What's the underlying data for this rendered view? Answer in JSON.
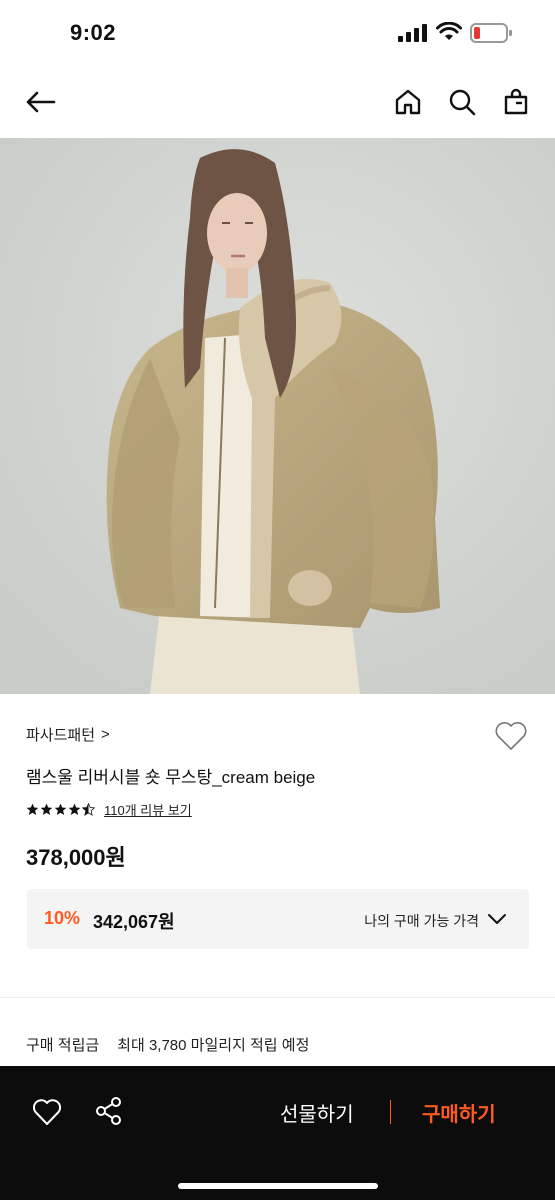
{
  "status_bar": {
    "time": "9:02"
  },
  "nav": {
    "back_icon": "arrow-left-icon",
    "home_icon": "home-icon",
    "search_icon": "search-icon",
    "bag_icon": "shopping-bag-icon"
  },
  "product": {
    "image_alt": "model wearing beige lambswool reversible shot mustang jacket",
    "brand": "파사드패턴",
    "brand_chevron": ">",
    "name": "램스울 리버시블 숏 무스탕_cream beige",
    "rating": 4.5,
    "review_link": "110개 리뷰 보기",
    "price": "378,000원",
    "discount_rate": "10%",
    "discount_price": "342,067원",
    "my_price_label": "나의 구매 가능 가격",
    "points_label": "구매 적립금",
    "points_text": "최대 3,780 마일리지 적립 예정"
  },
  "bottom_bar": {
    "gift_label": "선물하기",
    "buy_label": "구매하기",
    "heart_icon": "heart-outline-icon",
    "share_icon": "share-icon"
  },
  "colors": {
    "accent": "#ff5a1f",
    "bottom_bar_bg": "#0c0c0c",
    "box_bg": "#f4f4f4"
  }
}
